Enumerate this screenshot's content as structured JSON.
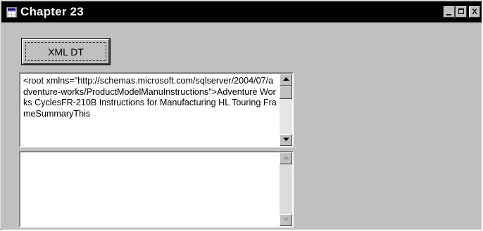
{
  "window": {
    "title": "Chapter 23",
    "controls": {
      "minimize": "_",
      "maximize": "□",
      "close": "X"
    }
  },
  "buttons": {
    "xml_dt_label": "XML DT"
  },
  "textbox_top": {
    "value": "<root xmlns=\"http://schemas.microsoft.com/sqlserver/2004/07/adventure-works/ProductModelManuInstructions\">Adventure Works CyclesFR-210B Instructions for Manufacturing HL Touring FrameSummaryThis"
  },
  "textbox_bottom": {
    "value": ""
  },
  "icons": {
    "app": "window-app-icon",
    "minimize": "minimize-icon",
    "maximize": "maximize-icon",
    "close": "close-icon",
    "scroll_up": "chevron-up-icon",
    "scroll_down": "chevron-down-icon"
  },
  "colors": {
    "titlebar": "#000000",
    "face": "#c0c0c0",
    "field": "#ffffff",
    "scrolltrack": "#e6e6e6"
  }
}
